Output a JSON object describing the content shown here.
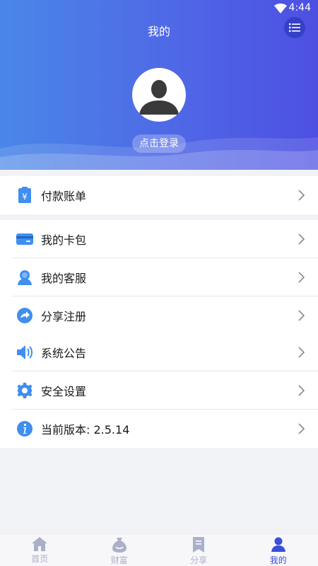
{
  "status_bar": {
    "time": "4:44"
  },
  "header": {
    "title": "我的"
  },
  "profile": {
    "login_label": "点击登录"
  },
  "menu_groups": [
    {
      "items": [
        {
          "label": "付款账单",
          "icon": "bill-icon"
        }
      ]
    },
    {
      "items": [
        {
          "label": "我的卡包",
          "icon": "card-icon"
        },
        {
          "label": "我的客服",
          "icon": "customer-service-icon"
        },
        {
          "label": "分享注册",
          "icon": "share-icon"
        }
      ]
    },
    {
      "items": [
        {
          "label": "系统公告",
          "icon": "speaker-icon"
        },
        {
          "label": "安全设置",
          "icon": "gear-icon"
        },
        {
          "label": "当前版本: 2.5.14",
          "icon": "info-icon"
        }
      ]
    }
  ],
  "tabbar": {
    "tabs": [
      {
        "label": "首页",
        "icon": "home-icon"
      },
      {
        "label": "财富",
        "icon": "money-bag-icon"
      },
      {
        "label": "分享",
        "icon": "bookmark-icon"
      },
      {
        "label": "我的",
        "icon": "user-icon",
        "active": true
      }
    ]
  },
  "colors": {
    "accent": "#3b4ed8",
    "icon_blue": "#3f8ef0",
    "inactive_tab": "#aab0c8"
  }
}
